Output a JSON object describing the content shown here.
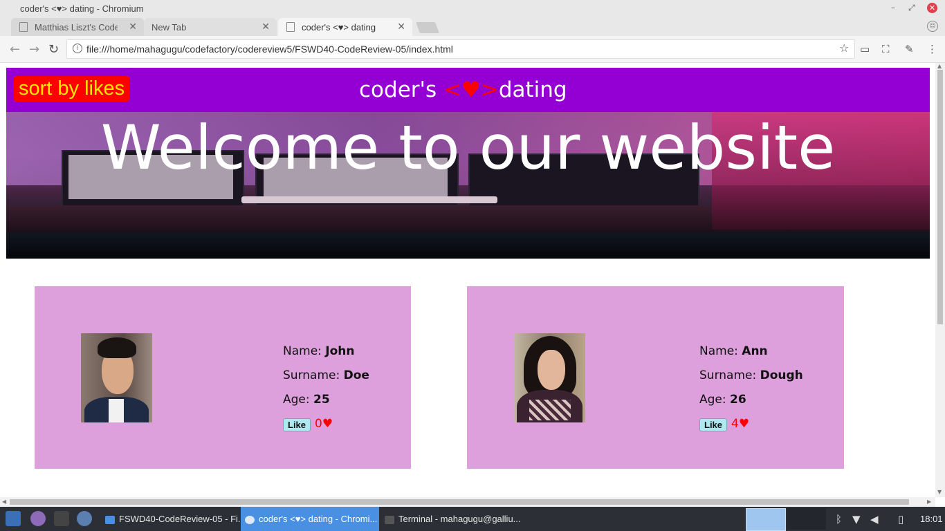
{
  "window": {
    "title": "coder's <♥> dating - Chromium",
    "controls": {
      "minimize": "–",
      "restore": "⤢",
      "close": "✕"
    }
  },
  "tabs": [
    {
      "label": "Matthias Liszt's Code P",
      "active": false
    },
    {
      "label": "New Tab",
      "active": false
    },
    {
      "label": "coder's <♥> dating",
      "active": true
    }
  ],
  "toolbar": {
    "url": "file:///home/mahagugu/codefactory/codereview5/FSWD40-CodeReview-05/index.html",
    "back_icon": "←",
    "forward_icon": "→",
    "reload_icon": "↻",
    "info_icon": "i",
    "star_icon": "☆",
    "cast_icon": "▭",
    "fullscreen_icon": "⛶",
    "picker_icon": "✎",
    "menu_icon": "⋮"
  },
  "site": {
    "sort_button": "sort by likes",
    "brand_prefix": "coder's ",
    "brand_lt": "<",
    "brand_heart": "♥",
    "brand_gt": ">",
    "brand_suffix": "dating",
    "hero_title": "Welcome to our website"
  },
  "profiles": [
    {
      "name_label": "Name: ",
      "name": "John",
      "surname_label": "Surname: ",
      "surname": "Doe",
      "age_label": "Age: ",
      "age": "25",
      "like_label": "Like",
      "likes": "0♥"
    },
    {
      "name_label": "Name: ",
      "name": "Ann",
      "surname_label": "Surname: ",
      "surname": "Dough",
      "age_label": "Age: ",
      "age": "26",
      "like_label": "Like",
      "likes": "4♥"
    }
  ],
  "taskbar": {
    "apps": [
      {
        "label": "FSWD40-CodeReview-05 - Fi...",
        "active": false
      },
      {
        "label": "coder's <♥> dating - Chromi...",
        "active": true
      },
      {
        "label": "Terminal - mahagugu@galliu...",
        "active": false
      }
    ],
    "clock": "18:01"
  },
  "colors": {
    "header": "#9400d3",
    "sort_bg": "#ff0000",
    "sort_text": "#ffe600",
    "card": "#dda0dd",
    "like_btn": "#aee8f0",
    "heart": "#ff0000"
  }
}
